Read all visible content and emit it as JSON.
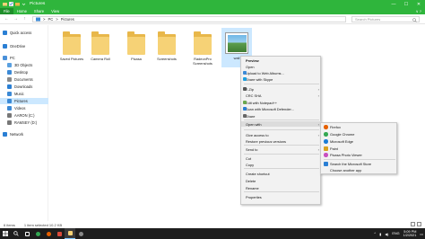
{
  "window": {
    "title": "Pictures",
    "min": "—",
    "max": "☐",
    "close": "✕"
  },
  "ribbon": {
    "tabs": [
      "File",
      "Home",
      "Share",
      "View"
    ],
    "help": "∨ ?"
  },
  "address": {
    "back": "←",
    "forward": "→",
    "up": "↑",
    "crumbs": [
      "PC",
      "Pictures"
    ],
    "sep": ">",
    "search_placeholder": "Search Pictures"
  },
  "sidebar": {
    "items": [
      {
        "label": "Quick access",
        "icon": "star-icon",
        "color": "#2a7fd4"
      },
      {
        "label": "OneDrive",
        "icon": "cloud-icon",
        "color": "#2a7fd4"
      },
      {
        "label": "PC",
        "icon": "computer-icon",
        "color": "#4a90d9"
      },
      {
        "label": "3D Objects",
        "icon": "cube-icon",
        "color": "#5aa0e0"
      },
      {
        "label": "Desktop",
        "icon": "desktop-icon",
        "color": "#3c8ad6"
      },
      {
        "label": "Documents",
        "icon": "document-icon",
        "color": "#8a8a8a"
      },
      {
        "label": "Downloads",
        "icon": "download-icon",
        "color": "#2a7fd4"
      },
      {
        "label": "Music",
        "icon": "music-icon",
        "color": "#3c8ad6"
      },
      {
        "label": "Pictures",
        "icon": "picture-icon",
        "color": "#3c8ad6"
      },
      {
        "label": "Videos",
        "icon": "video-icon",
        "color": "#3c8ad6"
      },
      {
        "label": "AARON (C:)",
        "icon": "drive-icon",
        "color": "#777777"
      },
      {
        "label": "RAMSEY (D:)",
        "icon": "drive-icon",
        "color": "#777777"
      },
      {
        "label": "Network",
        "icon": "network-icon",
        "color": "#2a7fd4"
      }
    ]
  },
  "files": [
    {
      "label": "Saved Pictures",
      "type": "folder"
    },
    {
      "label": "Camera Roll",
      "type": "folder"
    },
    {
      "label": "Picasa",
      "type": "folder"
    },
    {
      "label": "Screenshots",
      "type": "folder"
    },
    {
      "label": "RadeonPro Screenshots",
      "type": "folder"
    },
    {
      "label": "wall",
      "type": "image"
    }
  ],
  "context_menu": {
    "items": [
      "Preview",
      "Open",
      "Upload to Web Albums...",
      "Share with Skype",
      "7-Zip",
      "CRC SHA",
      "Edit with Notepad++",
      "Scan with Microsoft Defender...",
      "Share",
      "Open with",
      "Give access to",
      "Restore previous versions",
      "Send to",
      "Cut",
      "Copy",
      "Create shortcut",
      "Delete",
      "Rename",
      "Properties"
    ],
    "arrow": "›"
  },
  "open_with": {
    "items": [
      {
        "label": "Firefox",
        "color": "#e66000"
      },
      {
        "label": "Google Chrome",
        "color": "#34a853"
      },
      {
        "label": "Microsoft Edge",
        "color": "#1b7dd6"
      },
      {
        "label": "Paint",
        "color": "#d9a21e"
      },
      {
        "label": "Picasa Photo Viewer",
        "color": "#c84fbf"
      },
      {
        "label": "Search the Microsoft Store",
        "color": "#2a7fd4"
      },
      {
        "label": "Choose another app",
        "color": ""
      }
    ]
  },
  "status": {
    "items_count": "6 items",
    "selected": "1 item selected  10.2 KB"
  },
  "taskbar": {
    "lang": "ENG",
    "time": "5:09 PM",
    "date": "1/2/2021"
  }
}
